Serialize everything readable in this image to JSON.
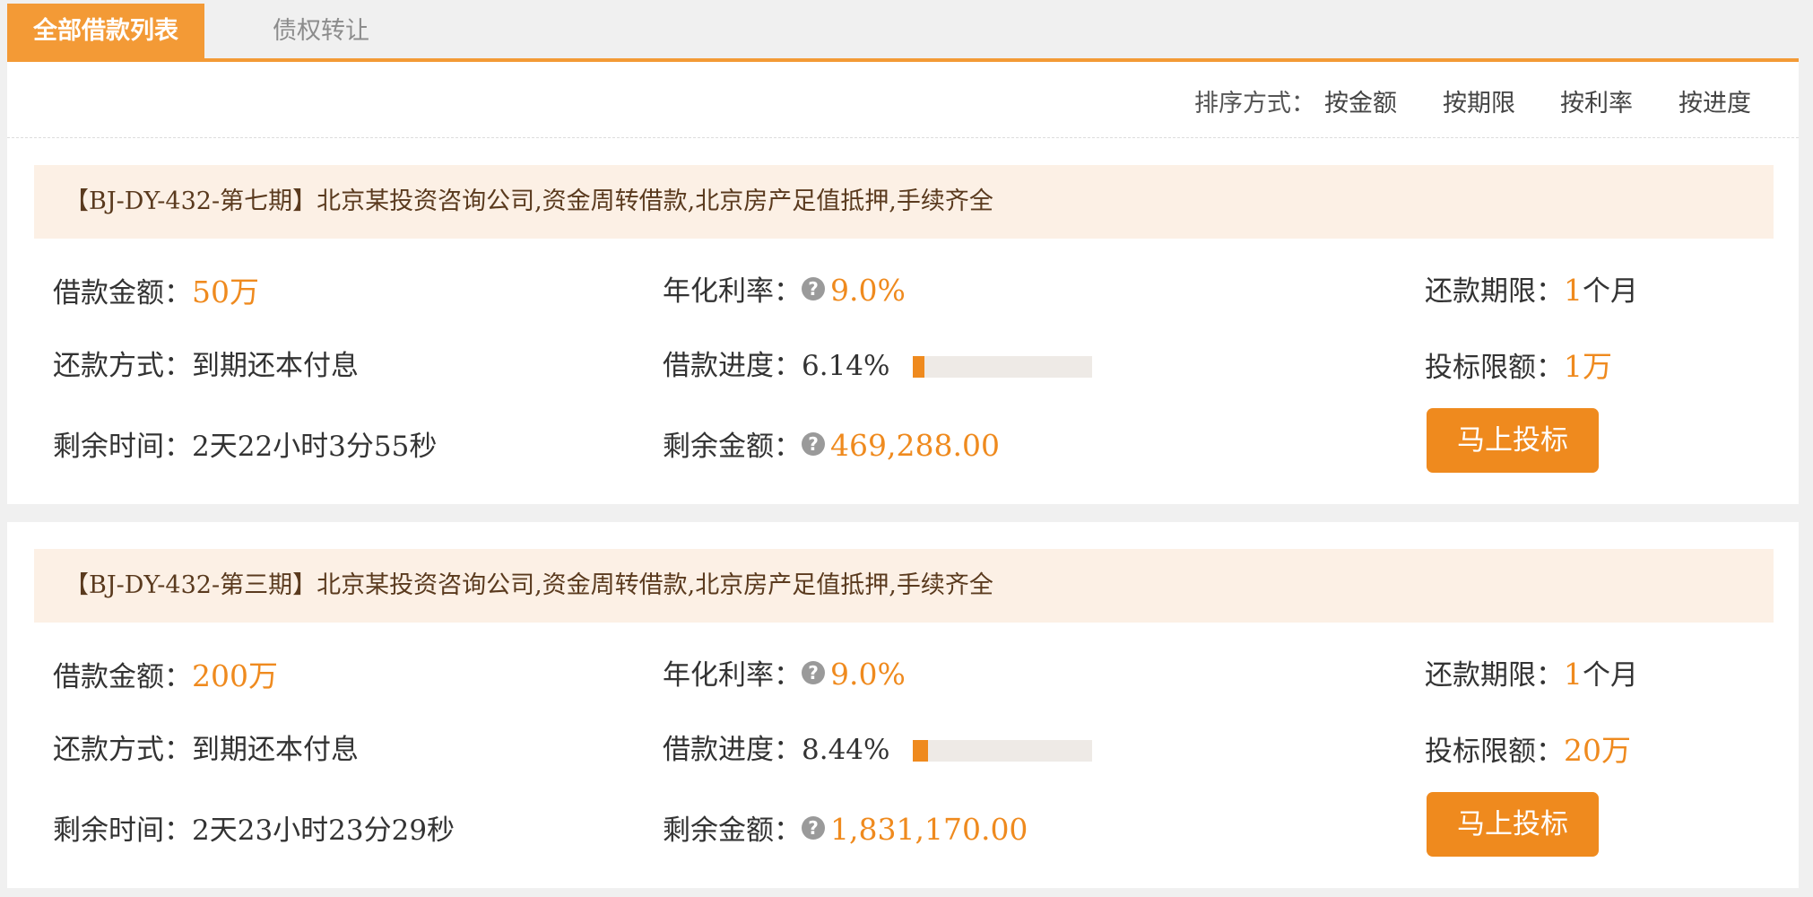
{
  "tabs": [
    {
      "label": "全部借款列表"
    },
    {
      "label": "债权转让"
    }
  ],
  "sort": {
    "label": "排序方式：",
    "options": [
      "按金额",
      "按期限",
      "按利率",
      "按进度"
    ]
  },
  "labels": {
    "amount": "借款金额：",
    "rate": "年化利率：",
    "term": "还款期限：",
    "method": "还款方式：",
    "progress": "借款进度：",
    "limit": "投标限额：",
    "remaining_time": "剩余时间：",
    "remaining_amount": "剩余金额：",
    "help_icon": "?",
    "term_unit": "个月"
  },
  "loans": [
    {
      "title": "【BJ-DY-432-第七期】北京某投资咨询公司,资金周转借款,北京房产足值抵押,手续齐全",
      "amount": "50万",
      "rate": "9.0%",
      "term_value": "1",
      "method": "到期还本付息",
      "progress_text": "6.14%",
      "progress_fraction": 0.0614,
      "limit": "1万",
      "remaining_time": "2天22小时3分55秒",
      "remaining_amount": "469,288.00",
      "button": "马上投标"
    },
    {
      "title": "【BJ-DY-432-第三期】北京某投资咨询公司,资金周转借款,北京房产足值抵押,手续齐全",
      "amount": "200万",
      "rate": "9.0%",
      "term_value": "1",
      "method": "到期还本付息",
      "progress_text": "8.44%",
      "progress_fraction": 0.0844,
      "limit": "20万",
      "remaining_time": "2天23小时23分29秒",
      "remaining_amount": "1,831,170.00",
      "button": "马上投标"
    }
  ],
  "colors": {
    "accent": "#f39a36",
    "highlight": "#ef8a1e",
    "title_bg": "#fcf0e5",
    "page_bg": "#f0f0f0"
  }
}
